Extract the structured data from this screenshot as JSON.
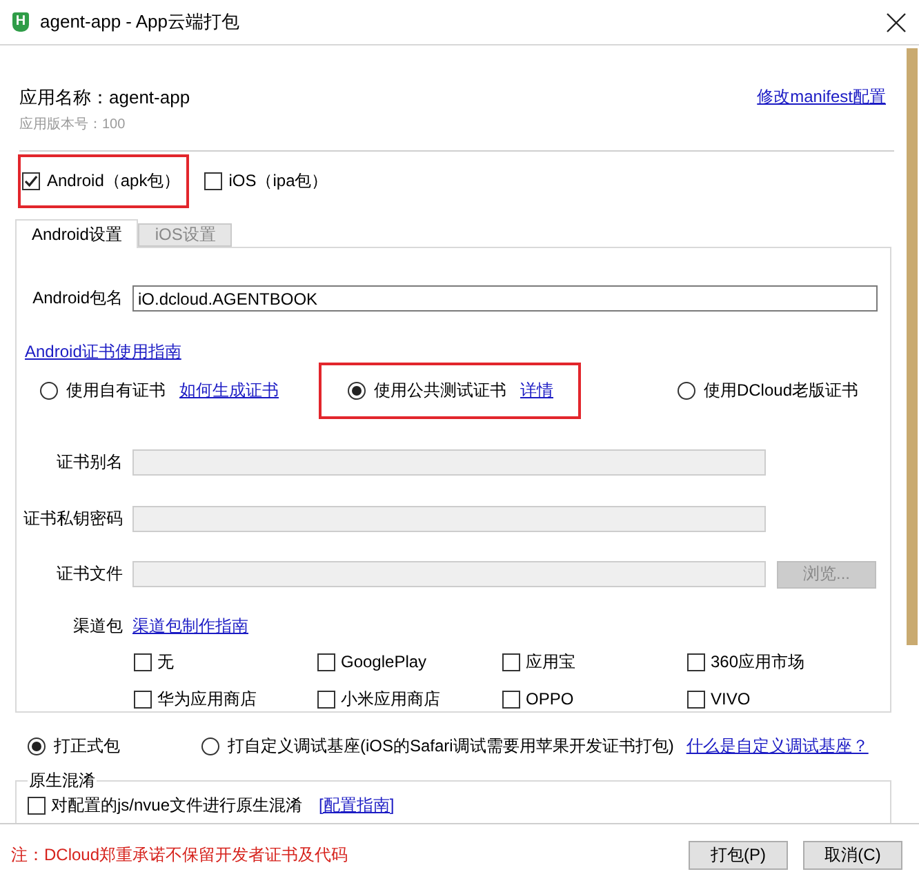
{
  "window": {
    "logo": "H",
    "title": "agent-app - App云端打包"
  },
  "header": {
    "app_name": "应用名称：agent-app",
    "version": "应用版本号：100",
    "manifest_link": "修改manifest配置"
  },
  "platforms": [
    {
      "label": "Android（apk包）",
      "checked": true,
      "highlighted": true
    },
    {
      "label": "iOS（ipa包）",
      "checked": false,
      "highlighted": false
    }
  ],
  "tabs": [
    {
      "label": "Android设置",
      "selected": true
    },
    {
      "label": "iOS设置",
      "selected": false
    }
  ],
  "android": {
    "package_label": "Android包名",
    "package_name": "iO.dcloud.AGENTBOOK",
    "cert_guide_link": "Android证书使用指南",
    "cert_options": [
      {
        "label": "使用自有证书",
        "link": "如何生成证书",
        "selected": false,
        "highlighted": false
      },
      {
        "label": "使用公共测试证书",
        "link": "详情",
        "selected": true,
        "highlighted": true
      },
      {
        "label": "使用DCloud老版证书",
        "selected": false,
        "highlighted": false
      }
    ],
    "cert_fields": [
      {
        "label": "证书别名",
        "disabled": true
      },
      {
        "label": "证书私钥密码",
        "disabled": true
      },
      {
        "label": "证书文件",
        "disabled": true,
        "button": {
          "label": "浏览...",
          "disabled": true
        }
      }
    ],
    "channel_label": "渠道包",
    "channel_guide_link": "渠道包制作指南",
    "channels": [
      {
        "label": "无",
        "checked": false
      },
      {
        "label": "GooglePlay",
        "checked": false
      },
      {
        "label": "应用宝",
        "checked": false
      },
      {
        "label": "360应用市场",
        "checked": false
      },
      {
        "label": "华为应用商店",
        "checked": false
      },
      {
        "label": "小米应用商店",
        "checked": false
      },
      {
        "label": "OPPO",
        "checked": false
      },
      {
        "label": "VIVO",
        "checked": false
      }
    ]
  },
  "build_types": [
    {
      "label": "打正式包",
      "selected": true
    },
    {
      "label": "打自定义调试基座(iOS的Safari调试需要用苹果开发证书打包)",
      "selected": false
    }
  ],
  "build_help_link": "什么是自定义调试基座？",
  "obfuscation": {
    "title": "原生混淆",
    "label": "对配置的js/nvue文件进行原生混淆",
    "checked": false,
    "link": "[配置指南]"
  },
  "footer": {
    "note": "注：DCloud郑重承诺不保留开发者证书及代码",
    "buttons": [
      "打包(P)",
      "取消(C)"
    ]
  }
}
